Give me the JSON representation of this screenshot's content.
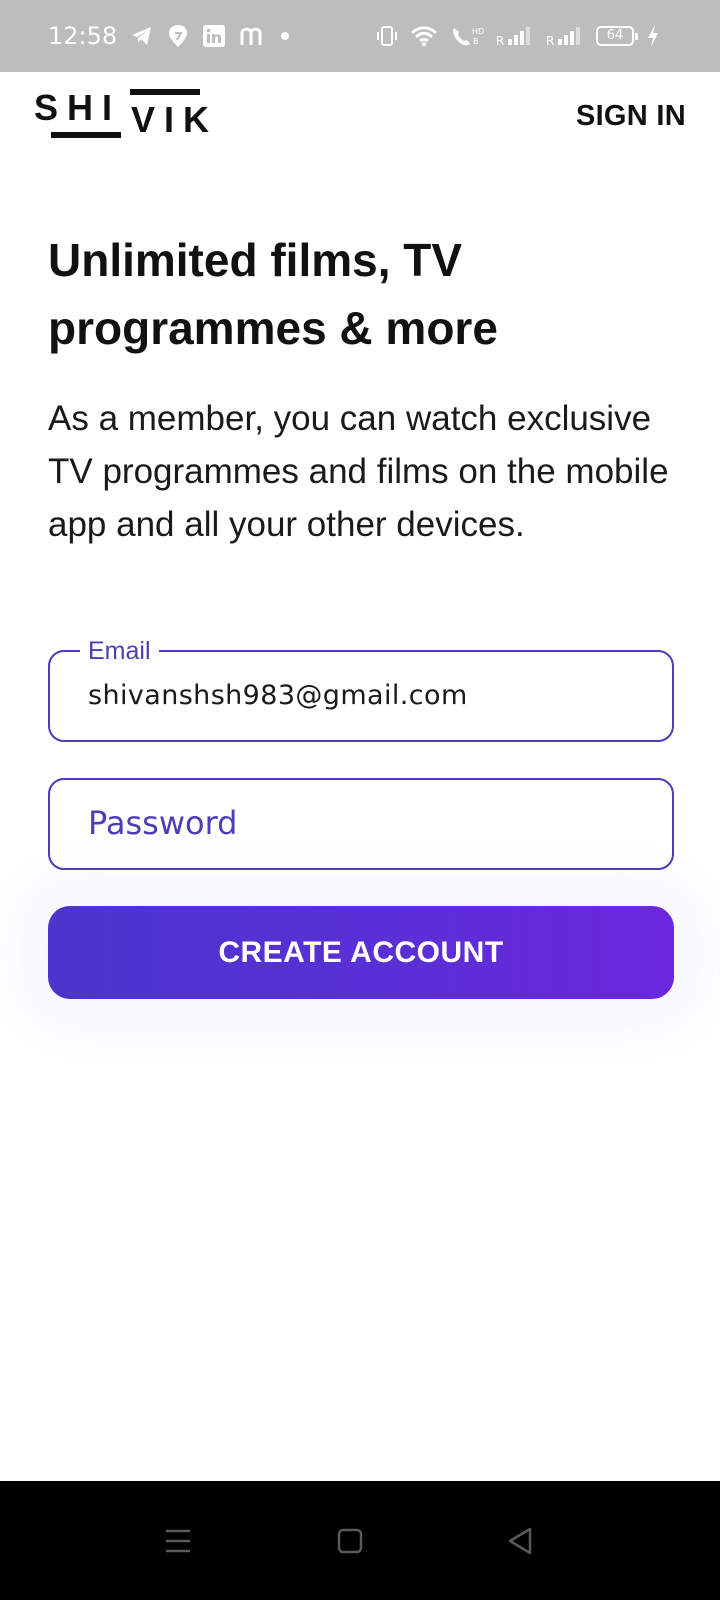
{
  "status_bar": {
    "time": "12:58",
    "left_icons": [
      "telegram-icon",
      "swiggy-icon",
      "linkedin-icon",
      "m-app-icon",
      "notification-dot-icon"
    ],
    "right_icons": [
      "vibrate-icon",
      "wifi-icon",
      "volte-call-icon",
      "signal-r-1-icon",
      "signal-r-2-icon",
      "battery-icon",
      "charging-icon"
    ],
    "battery_level": "64"
  },
  "header": {
    "logo_text": "SHIVIK",
    "sign_in_label": "SIGN IN"
  },
  "main": {
    "headline": "Unlimited films, TV programmes & more",
    "description": "As a member, you can watch exclusive TV programmes and films on the mobile app and all your other devices."
  },
  "form": {
    "email_label": "Email",
    "email_value": "shivanshsh983@gmail.com",
    "password_placeholder": "Password",
    "create_account_label": "CREATE ACCOUNT"
  },
  "colors": {
    "accent": "#4a3fb6",
    "button_gradient_start": "#4a36cc",
    "button_gradient_end": "#6b27dc",
    "status_bar_bg": "#bdbdbd",
    "nav_bar_bg": "#000000"
  },
  "nav_bar": {
    "icons": [
      "recents-icon",
      "home-icon",
      "back-icon"
    ]
  }
}
